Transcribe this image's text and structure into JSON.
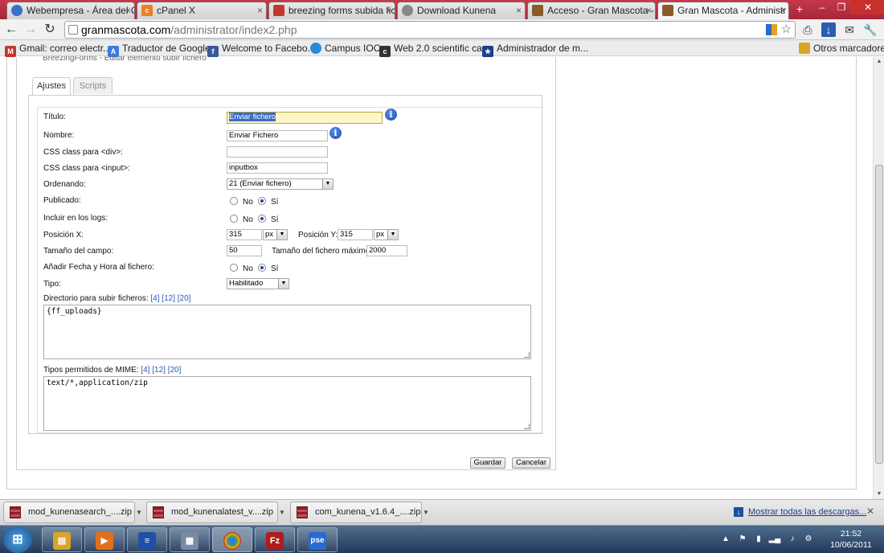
{
  "browser": {
    "tabs": [
      {
        "title": "Webempresa - Área del Cl",
        "favicon_color": "#3a6fc7",
        "icon": "globe-icon"
      },
      {
        "title": "cPanel X",
        "favicon_color": "#f07c1e",
        "icon": "cpanel-icon"
      },
      {
        "title": "breezing forms subida fich",
        "favicon_color": "#c0392b",
        "icon": "forum-icon"
      },
      {
        "title": "Download Kunena",
        "favicon_color": "#666666",
        "icon": "globe-icon"
      },
      {
        "title": "Acceso - Gran Mascota -",
        "favicon_color": "#8b5a2b",
        "icon": "site-icon"
      },
      {
        "title": "Gran Mascota - Administr",
        "favicon_color": "#8b5a2b",
        "icon": "site-icon"
      }
    ],
    "url_domain": "granmascota.com",
    "url_path": "/administrator/index2.php",
    "bookmarks": [
      {
        "label": "Gmail: correo electr...",
        "color": "#c0392b",
        "icon": "gmail-icon"
      },
      {
        "label": "Traductor de Google",
        "color": "#3b7ae0",
        "icon": "translate-icon"
      },
      {
        "label": "Welcome to Facebo...",
        "color": "#3b5998",
        "icon": "facebook-icon"
      },
      {
        "label": "Campus IOC",
        "color": "#2a8ad4",
        "icon": "globe-icon"
      },
      {
        "label": "Web 2.0 scientific ca...",
        "color": "#333333",
        "icon": "calc-icon"
      },
      {
        "label": "Administrador de m...",
        "color": "#1b3f8a",
        "icon": "star-icon"
      }
    ],
    "other_bookmarks": "Otros marcadores"
  },
  "panel": {
    "title_cut": "BreezingForms - Editar elemento subir fichero",
    "tabs": [
      "Ajustes",
      "Scripts"
    ]
  },
  "form": {
    "titulo_label": "Título:",
    "titulo_value": "Enviar fichero",
    "nombre_label": "Nombre:",
    "nombre_value": "Enviar Fichero",
    "css_div_label": "CSS class para <div>:",
    "css_div_value": "",
    "css_input_label": "CSS class para <input>:",
    "css_input_value": "inputbox",
    "ordenando_label": "Ordenando:",
    "ordenando_value": "21 (Enviar fichero)",
    "publicado_label": "Publicado:",
    "logs_label": "Incluir en los logs:",
    "posx_label": "Posición X:",
    "posx_value": "315",
    "posx_unit": "px",
    "posy_label": "Posición Y:",
    "posy_value": "315",
    "posy_unit": "px",
    "tamano_label": "Tamaño del campo:",
    "tamano_value": "50",
    "max_label": "Tamaño del fichero máximo:",
    "max_value": "2000",
    "fecha_label": "Añadir Fecha y Hora al fichero:",
    "tipo_label": "Tipo:",
    "tipo_value": "Habilitado",
    "dir_label": "Directorio para subir ficheros:",
    "dir_value": "{ff_uploads}",
    "mime_label": "Tipos permitidos de MIME:",
    "mime_value": "text/*,application/zip",
    "ref_links": [
      "[4]",
      "[12]",
      "[20]"
    ],
    "no_label": "No",
    "si_label": "Sí",
    "save_label": "Guardar",
    "cancel_label": "Cancelar"
  },
  "downloads": {
    "items": [
      "mod_kunenasearch_....zip",
      "mod_kunenalatest_v....zip",
      "com_kunena_v1.6.4_....zip"
    ],
    "show_all": "Mostrar todas las descargas..."
  },
  "taskbar": {
    "time": "21:52",
    "date": "10/06/2011",
    "apps": [
      {
        "name": "explorer",
        "color": "#d8a526",
        "glyph": "▤"
      },
      {
        "name": "media-player",
        "color": "#e0711c",
        "glyph": "▶"
      },
      {
        "name": "stack-app",
        "color": "#1f4fa8",
        "glyph": "≡"
      },
      {
        "name": "calculator",
        "color": "#7a8aa0",
        "glyph": "▦"
      },
      {
        "name": "chrome",
        "color": "#2f9e44",
        "glyph": "●"
      },
      {
        "name": "filezilla",
        "color": "#b01c1c",
        "glyph": "Fz"
      },
      {
        "name": "pse",
        "color": "#2a6ad0",
        "glyph": "pse"
      }
    ]
  }
}
